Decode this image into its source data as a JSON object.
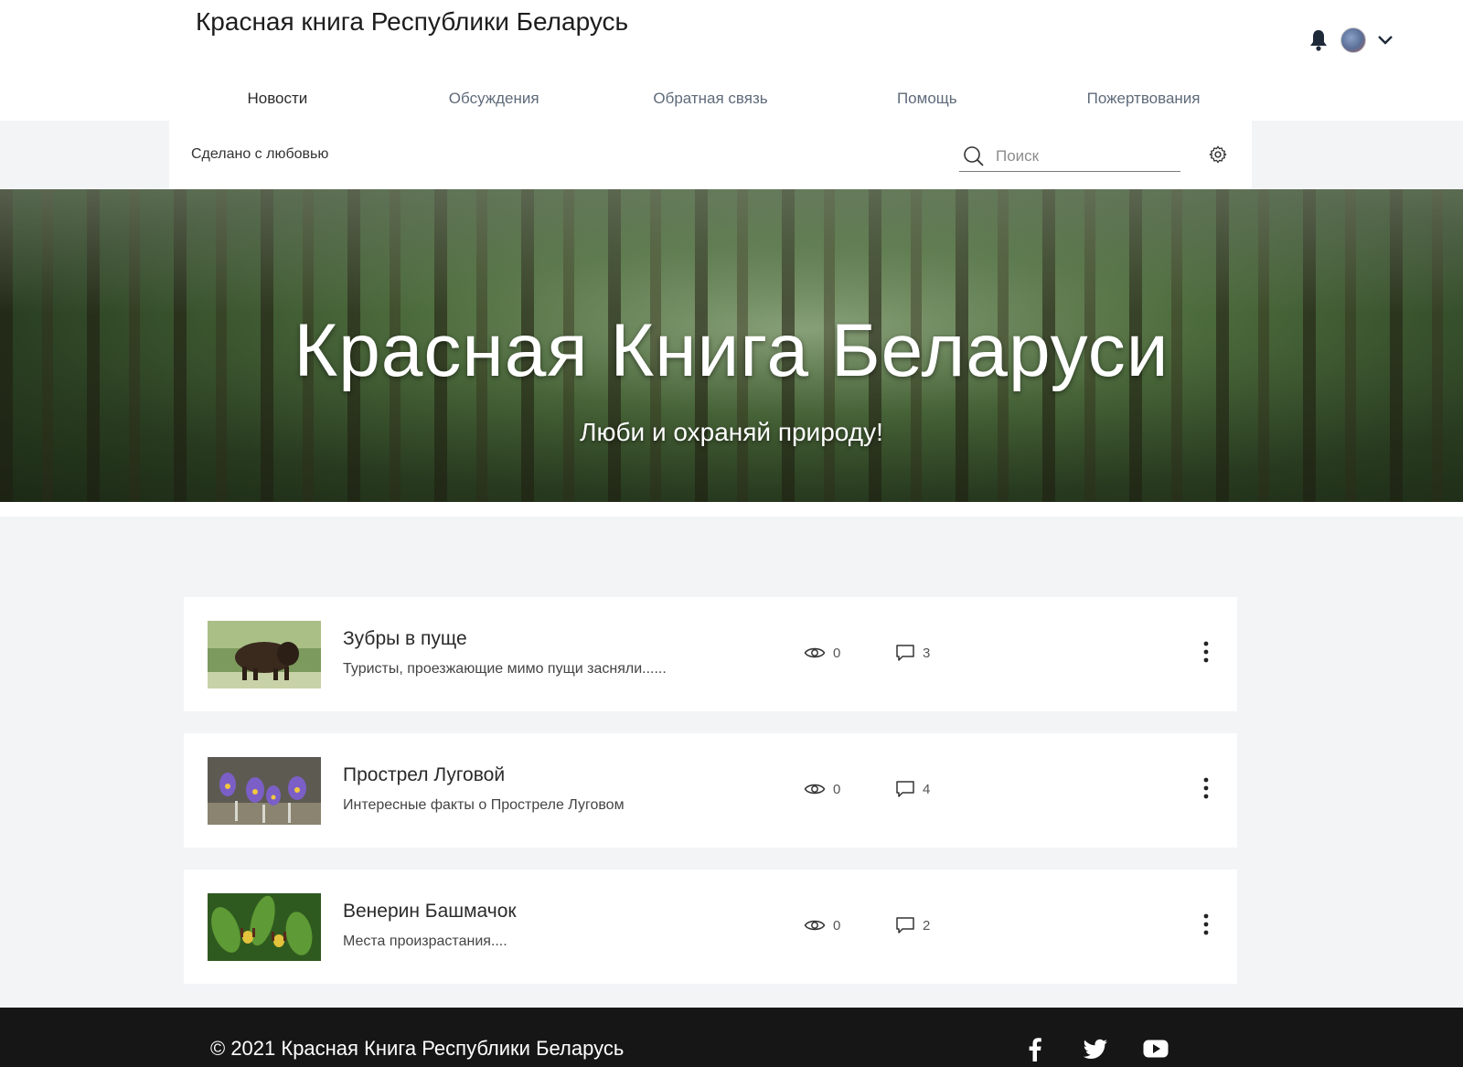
{
  "header": {
    "site_title": "Красная книга Республики Беларусь",
    "icons": [
      "bell-icon",
      "avatar",
      "chevron-down-icon"
    ]
  },
  "nav": {
    "items": [
      {
        "label": "Новости",
        "active": true
      },
      {
        "label": "Обсуждения",
        "active": false
      },
      {
        "label": "Обратная связь",
        "active": false
      },
      {
        "label": "Помощь",
        "active": false
      },
      {
        "label": "Пожертвования",
        "active": false
      }
    ]
  },
  "subbar": {
    "tagline": "Сделано с любовью",
    "search_placeholder": "Поиск"
  },
  "hero": {
    "title": "Красная Книга Беларуси",
    "subtitle": "Люби и охраняй природу!"
  },
  "posts": [
    {
      "title": "Зубры в пуще",
      "desc": "Туристы, проезжающие мимо пущи засняли......",
      "views": "0",
      "comments": "3",
      "thumb": "bison"
    },
    {
      "title": "Прострел Луговой",
      "desc": "Интересные факты о Прострелe Луговом",
      "views": "0",
      "comments": "4",
      "thumb": "pasqueflower"
    },
    {
      "title": "Венерин Башмачок",
      "desc": "Места произрастания....",
      "views": "0",
      "comments": "2",
      "thumb": "ladys-slipper"
    }
  ],
  "footer": {
    "copyright": "© 2021 Красная Книга Республики Беларусь",
    "social": [
      "facebook-icon",
      "twitter-icon",
      "youtube-icon"
    ]
  }
}
